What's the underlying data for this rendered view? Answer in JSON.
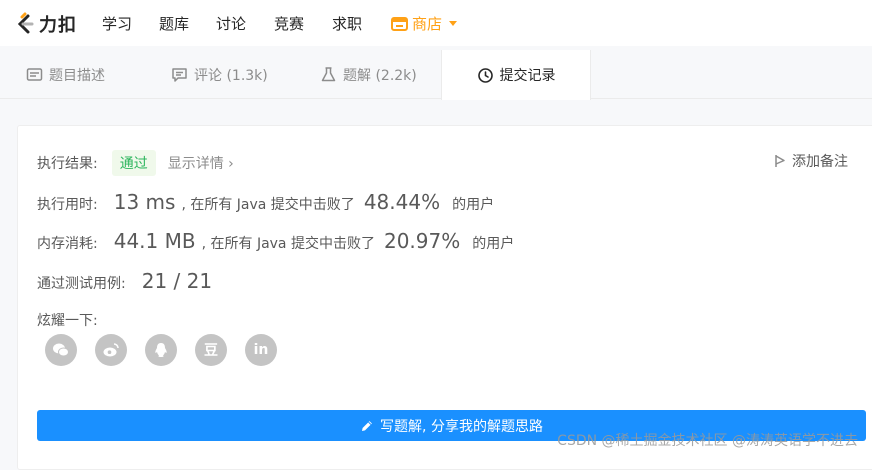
{
  "nav": {
    "logo_text": "力扣",
    "items": [
      "学习",
      "题库",
      "讨论",
      "竞赛",
      "求职"
    ],
    "shop_label": "商店",
    "brand_color": "#ffa116"
  },
  "tabs": [
    {
      "label": "题目描述",
      "icon": "description-icon"
    },
    {
      "label": "评论 (1.3k)",
      "icon": "comment-icon"
    },
    {
      "label": "题解 (2.2k)",
      "icon": "flask-icon"
    },
    {
      "label": "提交记录",
      "icon": "clock-icon",
      "active": true
    }
  ],
  "result": {
    "label": "执行结果:",
    "status": "通过",
    "status_color": "#2db55d",
    "details_link": "显示详情 ›",
    "note_label": "添加备注"
  },
  "runtime": {
    "label": "执行用时:",
    "value": "13 ms",
    "mid_text": ", 在所有 Java 提交中击败了",
    "percent": "48.44%",
    "suffix": "的用户"
  },
  "memory": {
    "label": "内存消耗:",
    "value": "44.1 MB",
    "mid_text": ", 在所有 Java 提交中击败了",
    "percent": "20.97%",
    "suffix": "的用户"
  },
  "tests": {
    "label": "通过测试用例:",
    "value": "21 / 21"
  },
  "share": {
    "label": "炫耀一下:",
    "icons": [
      "wechat-icon",
      "weibo-icon",
      "qq-icon",
      "douban-icon",
      "linkedin-icon"
    ],
    "douban_glyph": "豆",
    "linkedin_glyph": "in"
  },
  "write_button": {
    "label": "写题解, 分享我的解题思路",
    "color": "#1a90ff"
  },
  "watermark": "CSDN @稀土掘金技术社区 @涛涛英语学不进去"
}
